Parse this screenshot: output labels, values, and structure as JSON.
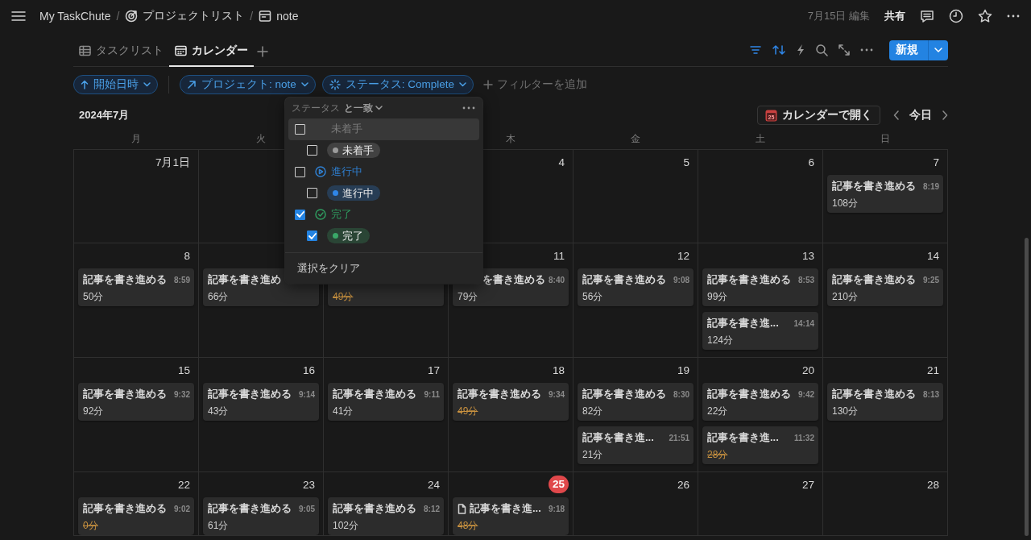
{
  "topbar": {
    "breadcrumbs": [
      {
        "kind": "workspace",
        "label": "My TaskChute"
      },
      {
        "kind": "project_list",
        "separator": "/",
        "label": "プロジェクトリスト"
      },
      {
        "kind": "page",
        "separator": "/",
        "label": "note"
      }
    ],
    "edited": "7月15日 編集",
    "share": "共有"
  },
  "views": {
    "tabs": [
      {
        "kind": "table",
        "label": "タスクリスト",
        "selected": false
      },
      {
        "kind": "calendar",
        "label": "カレンダー",
        "selected": true
      }
    ],
    "tools": [
      {
        "kind": "filter",
        "active": true
      },
      {
        "kind": "sort",
        "active": true
      },
      {
        "kind": "automation",
        "active": false
      },
      {
        "kind": "search",
        "active": false
      },
      {
        "kind": "expand",
        "active": false
      },
      {
        "kind": "more",
        "active": false
      }
    ],
    "new_button": "新規"
  },
  "filters": {
    "chips": [
      {
        "kind": "sort",
        "label": "開始日時"
      },
      {
        "kind": "relation",
        "label": "プロジェクト: note"
      },
      {
        "kind": "status",
        "label": "ステータス: Complete"
      }
    ],
    "add_label": "フィルターを追加"
  },
  "calendar": {
    "month": "2024年7月",
    "open_button": {
      "label": "カレンダーで開く",
      "icon_day": "25"
    },
    "today_button": "今日",
    "weekdays_before_menu": [
      {
        "label": "月"
      },
      {
        "label": "火"
      }
    ],
    "weekdays_after_menu": [
      {
        "label": "木"
      },
      {
        "label": "金"
      },
      {
        "label": "土"
      },
      {
        "label": "日"
      }
    ],
    "weeks": [
      {
        "days_before_menu": [
          {
            "date": "7月1日",
            "today": false
          }
        ],
        "days_after_menu": [
          {
            "date": "4",
            "today": false
          },
          {
            "date": "5",
            "today": false
          },
          {
            "date": "6",
            "today": false
          },
          {
            "date": "7",
            "today": false,
            "events": [
              {
                "kind": "task",
                "title": "記事を書き進める",
                "time": "8:19",
                "duration": "108分",
                "done": false
              }
            ]
          }
        ]
      },
      {
        "days": [
          {
            "date": "8",
            "today": false,
            "events": [
              {
                "kind": "task",
                "title": "記事を書き進める",
                "time": "8:59",
                "duration": "50分",
                "done": false
              }
            ]
          },
          {
            "events": [
              {
                "kind": "task",
                "title": "記事を書き進め",
                "duration": "66分",
                "done": false
              }
            ]
          },
          {
            "events": [
              {
                "kind": "task",
                "duration": "49分",
                "done": true
              }
            ]
          },
          {
            "date": "11",
            "today": false,
            "events": [
              {
                "kind": "task",
                "title": "を書き進める",
                "leading_hidden": true,
                "time": "8:40",
                "duration": "79分",
                "done": false
              }
            ]
          },
          {
            "date": "12",
            "today": false,
            "events": [
              {
                "kind": "task",
                "title": "記事を書き進める",
                "time": "9:08",
                "duration": "56分",
                "done": false
              }
            ]
          },
          {
            "date": "13",
            "today": false,
            "events": [
              {
                "kind": "task",
                "title": "記事を書き進める",
                "time": "8:53",
                "duration": "99分",
                "done": false
              },
              {
                "kind": "task",
                "title": "記事を書き進...",
                "time": "14:14",
                "duration": "124分",
                "done": false
              }
            ]
          },
          {
            "date": "14",
            "today": false,
            "events": [
              {
                "kind": "task",
                "title": "記事を書き進める",
                "time": "9:25",
                "duration": "210分",
                "done": false
              }
            ]
          }
        ]
      },
      {
        "days": [
          {
            "date": "15",
            "today": false,
            "events": [
              {
                "kind": "task",
                "title": "記事を書き進める",
                "time": "9:32",
                "duration": "92分",
                "done": false
              }
            ]
          },
          {
            "date": "16",
            "today": false,
            "events": [
              {
                "kind": "task",
                "title": "記事を書き進める",
                "time": "9:14",
                "duration": "43分",
                "done": false
              }
            ]
          },
          {
            "date": "17",
            "today": false,
            "events": [
              {
                "kind": "task",
                "title": "記事を書き進める",
                "time": "9:11",
                "duration": "41分",
                "done": false
              }
            ]
          },
          {
            "date": "18",
            "today": false,
            "events": [
              {
                "kind": "task",
                "title": "記事を書き進める",
                "time": "9:34",
                "duration": "49分",
                "done": true
              }
            ]
          },
          {
            "date": "19",
            "today": false,
            "events": [
              {
                "kind": "task",
                "title": "記事を書き進める",
                "time": "8:30",
                "duration": "82分",
                "done": false
              },
              {
                "kind": "task",
                "title": "記事を書き進...",
                "time": "21:51",
                "duration": "21分",
                "done": false
              }
            ]
          },
          {
            "date": "20",
            "today": false,
            "events": [
              {
                "kind": "task",
                "title": "記事を書き進める",
                "time": "9:42",
                "duration": "22分",
                "done": false
              },
              {
                "kind": "task",
                "title": "記事を書き進...",
                "time": "11:32",
                "duration": "28分",
                "done": true
              }
            ]
          },
          {
            "date": "21",
            "today": false,
            "events": [
              {
                "kind": "task",
                "title": "記事を書き進める",
                "time": "8:13",
                "duration": "130分",
                "done": false
              }
            ]
          }
        ]
      },
      {
        "days": [
          {
            "date": "22",
            "today": false,
            "events": [
              {
                "kind": "task",
                "title": "記事を書き進める",
                "time": "9:02",
                "duration": "0分",
                "done": true
              }
            ]
          },
          {
            "date": "23",
            "today": false,
            "events": [
              {
                "kind": "task",
                "title": "記事を書き進める",
                "time": "9:05",
                "duration": "61分",
                "done": false
              }
            ]
          },
          {
            "date": "24",
            "today": false,
            "events": [
              {
                "kind": "task",
                "title": "記事を書き進める",
                "time": "8:12",
                "duration": "102分",
                "done": false
              }
            ]
          },
          {
            "date": "25",
            "today": true,
            "events": [
              {
                "kind": "page",
                "title": "記事を書き進...",
                "time": "9:18",
                "duration": "48分",
                "done": true
              }
            ]
          },
          {
            "date": "26",
            "today": false
          },
          {
            "date": "27",
            "today": false
          },
          {
            "date": "28",
            "today": false
          }
        ]
      }
    ]
  },
  "status_popup": {
    "property": "ステータス",
    "operator": "と一致",
    "groups": [
      {
        "kind": "not_started",
        "label": "未着手",
        "color": "#7b7b7b",
        "checked": false,
        "highlighted": true,
        "children": [
          {
            "label": "未着手",
            "color": "#9b9b9b",
            "checked": false
          }
        ]
      },
      {
        "kind": "in_progress",
        "label": "進行中",
        "color": "#2f7fd0",
        "checked": false,
        "highlighted": false,
        "children": [
          {
            "label": "進行中",
            "color": "#2f86e8",
            "checked": false
          }
        ]
      },
      {
        "kind": "complete",
        "label": "完了",
        "color": "#2f9a5f",
        "checked": true,
        "highlighted": false,
        "children": [
          {
            "label": "完了",
            "color": "#3aa868",
            "checked": true
          }
        ]
      }
    ],
    "clear": "選択をクリア"
  }
}
